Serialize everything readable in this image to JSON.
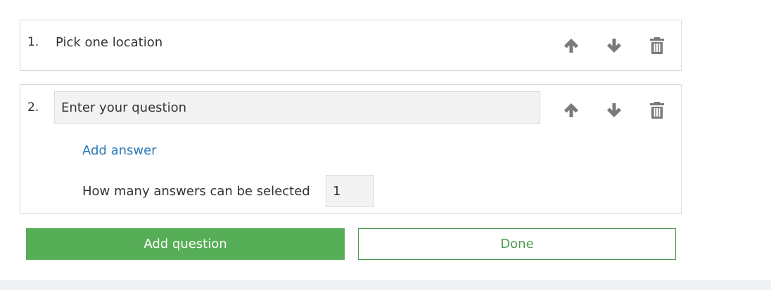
{
  "colors": {
    "primary_green": "#56ae57",
    "done_green": "#4e9a4f",
    "link_blue": "#2b79b5",
    "icon_gray": "#7a7a7a",
    "input_bg": "#f3f3f3",
    "border": "#d9d9d9"
  },
  "questions": [
    {
      "number": "1.",
      "text": "Pick one location",
      "icons": [
        "arrow-up-icon",
        "arrow-down-icon",
        "trash-icon"
      ]
    },
    {
      "number": "2.",
      "input_placeholder": "Enter your question",
      "add_answer_label": "Add answer",
      "max_answers_label": "How many answers can be selected",
      "max_answers_value": "1",
      "icons": [
        "arrow-up-icon",
        "arrow-down-icon",
        "trash-icon"
      ]
    }
  ],
  "actions": {
    "add_question_label": "Add question",
    "done_label": "Done"
  }
}
